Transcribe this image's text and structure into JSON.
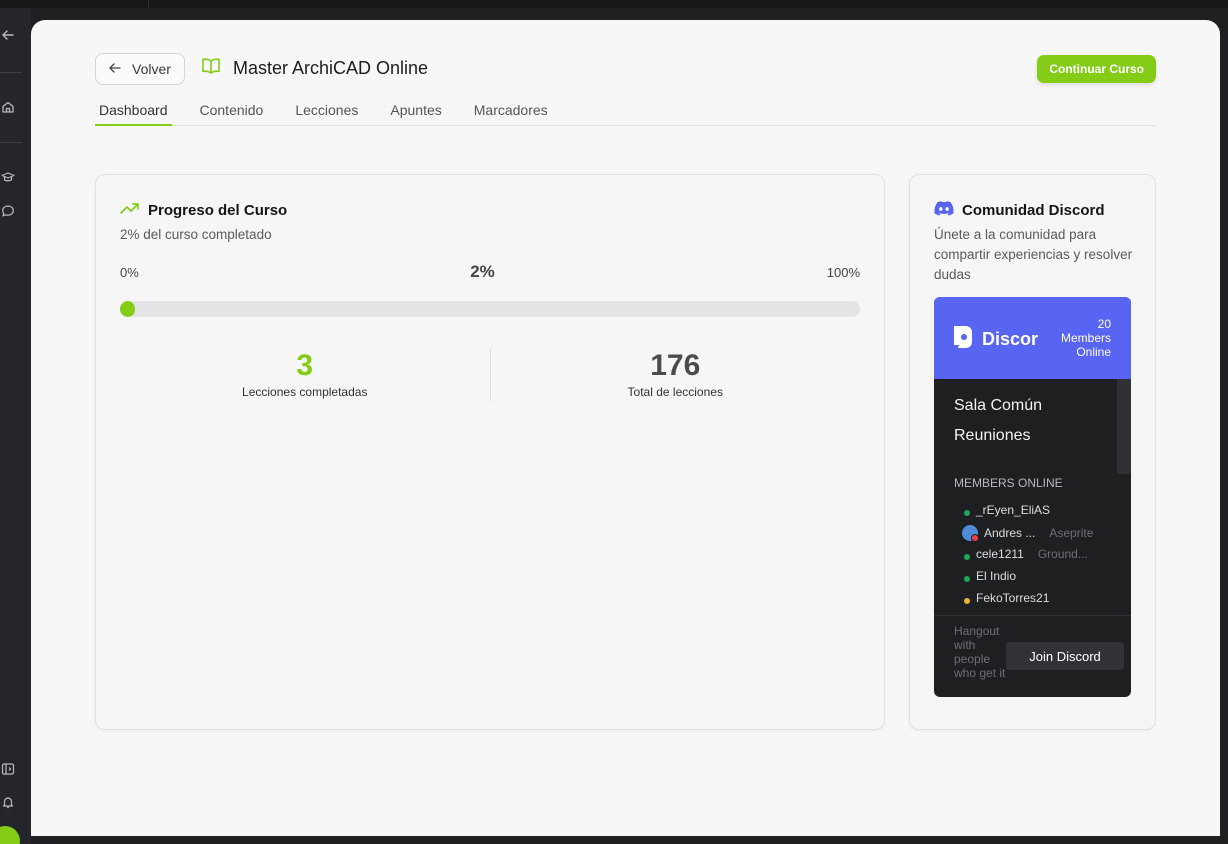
{
  "nav": {
    "back_label": "Volver",
    "continue_label": "Continuar Curso"
  },
  "course": {
    "title": "Master ArchiCAD Online"
  },
  "tabs": [
    {
      "label": "Dashboard",
      "active": true
    },
    {
      "label": "Contenido",
      "active": false
    },
    {
      "label": "Lecciones",
      "active": false
    },
    {
      "label": "Apuntes",
      "active": false
    },
    {
      "label": "Marcadores",
      "active": false
    }
  ],
  "progress": {
    "title": "Progreso del Curso",
    "subtitle": "2% del curso completado",
    "min_label": "0%",
    "current_label": "2%",
    "max_label": "100%",
    "percent": 2,
    "completed_count": "3",
    "completed_label": "Lecciones completadas",
    "total_count": "176",
    "total_label": "Total de lecciones"
  },
  "discord": {
    "title": "Comunidad Discord",
    "description": "Únete a la comunidad para compartir experiencias y resolver dudas",
    "widget": {
      "brand": "Discor",
      "members_count": "20",
      "members_text_1": "Members",
      "members_text_2": "Online",
      "channels": [
        "Sala Común",
        "Reuniones"
      ],
      "members_header": "MEMBERS ONLINE",
      "members": [
        {
          "name": "_rEyen_EliAS",
          "game": "",
          "status": "online"
        },
        {
          "name": "Andres ...",
          "game": "Aseprite",
          "status": "dnd"
        },
        {
          "name": "cele1211",
          "game": "Ground...",
          "status": "online"
        },
        {
          "name": "El Indio",
          "game": "",
          "status": "online"
        },
        {
          "name": "FekoTorres21",
          "game": "",
          "status": "idle"
        }
      ],
      "tagline": "Hangout with people who get it",
      "join_label": "Join Discord"
    }
  },
  "colors": {
    "accent": "#84cc16",
    "discord_blurple": "#5865f2",
    "discord_bg": "#1e1f22"
  },
  "icons": {
    "rail": [
      "arrow-left-icon",
      "home-icon",
      "graduation-cap-icon",
      "chat-bubble-icon",
      "sidebar-toggle-icon",
      "bell-icon"
    ],
    "title": "open-book-icon",
    "progress": "trending-up-icon",
    "discord": "discord-icon"
  }
}
